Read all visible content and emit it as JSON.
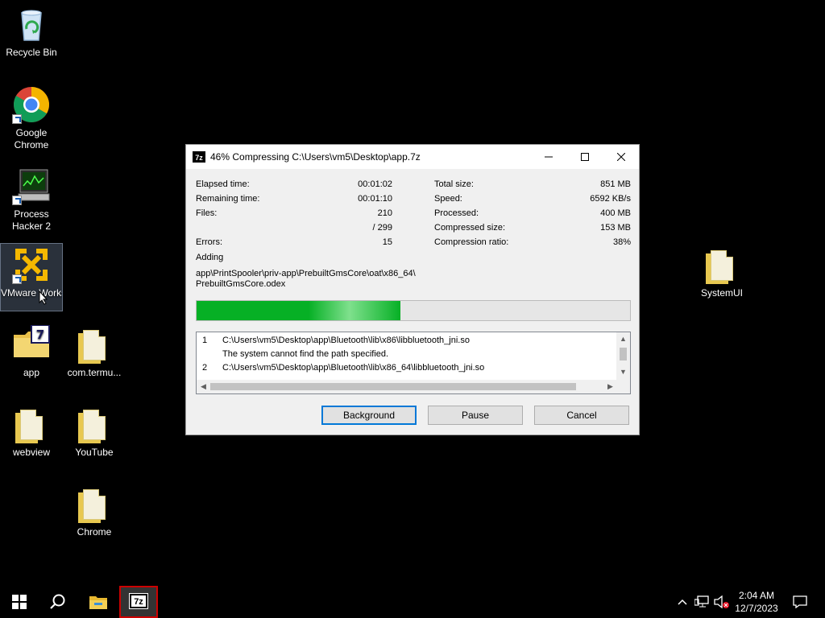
{
  "desktop": {
    "icons": [
      {
        "label": "Recycle Bin"
      },
      {
        "label": "Google Chrome"
      },
      {
        "label": "Process Hacker 2"
      },
      {
        "label": "VMware Workstati..."
      },
      {
        "label": "app"
      },
      {
        "label": "com.termu..."
      },
      {
        "label": "webview"
      },
      {
        "label": "YouTube"
      },
      {
        "label": "Chrome"
      },
      {
        "label": "SystemUI"
      }
    ]
  },
  "dialog": {
    "app_badge": "7z",
    "title": "46% Compressing C:\\Users\\vm5\\Desktop\\app.7z",
    "left_stats": [
      {
        "label": "Elapsed time:",
        "value": "00:01:02"
      },
      {
        "label": "Remaining time:",
        "value": "00:01:10"
      },
      {
        "label": "Files:",
        "value": "210"
      },
      {
        "label": "",
        "value": "/ 299"
      },
      {
        "label": "Errors:",
        "value": "15"
      }
    ],
    "right_stats": [
      {
        "label": "Total size:",
        "value": "851 MB"
      },
      {
        "label": "Speed:",
        "value": "6592 KB/s"
      },
      {
        "label": "Processed:",
        "value": "400 MB"
      },
      {
        "label": "Compressed size:",
        "value": "153 MB"
      },
      {
        "label": "Compression ratio:",
        "value": "38%"
      }
    ],
    "adding_label": "Adding",
    "current_path_line1": "app\\PrintSpooler\\priv-app\\PrebuiltGmsCore\\oat\\x86_64\\",
    "current_path_line2": "PrebuiltGmsCore.odex",
    "progress_fraction": 0.47,
    "progress_color": "#06b025",
    "log": [
      {
        "num": "1",
        "text": "C:\\Users\\vm5\\Desktop\\app\\Bluetooth\\lib\\x86\\libbluetooth_jni.so"
      },
      {
        "num": "",
        "text": "The system cannot find the path specified."
      },
      {
        "num": "2",
        "text": "C:\\Users\\vm5\\Desktop\\app\\Bluetooth\\lib\\x86_64\\libbluetooth_jni.so"
      }
    ],
    "buttons": {
      "background": "Background",
      "pause": "Pause",
      "cancel": "Cancel"
    }
  },
  "taskbar": {
    "time": "2:04 AM",
    "date": "12/7/2023",
    "active_app_badge": "7z",
    "accent": "#0078d7"
  }
}
